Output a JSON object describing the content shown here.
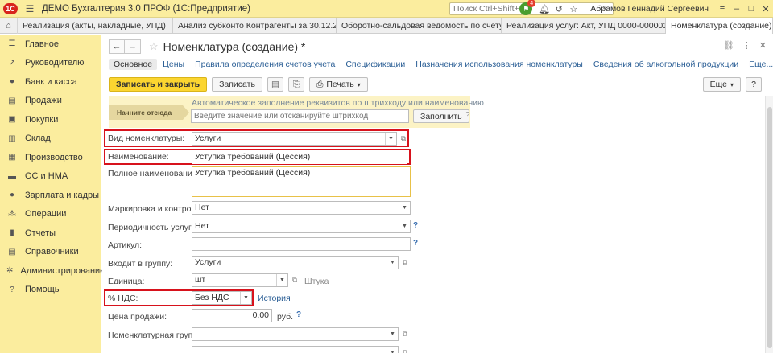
{
  "titlebar": {
    "logo": "1С",
    "title": "ДЕМО Бухгалтерия 3.0 ПРОФ  (1С:Предприятие)",
    "search_placeholder": "Поиск Ctrl+Shift+F",
    "notification_count": "4",
    "user": "Абрамов Геннадий Сергеевич"
  },
  "tabs": [
    {
      "label": "Реализация (акты, накладные, УПД)"
    },
    {
      "label": "Анализ субконто Контрагенты за 30.12.20..."
    },
    {
      "label": "Оборотно-сальдовая ведомость по счету ..."
    },
    {
      "label": "Реализация услуг: Акт, УПД 0000-000001 о..."
    },
    {
      "label": "Номенклатура (создание) *"
    }
  ],
  "sidebar": {
    "items": [
      {
        "icon": "menu-icon",
        "glyph": "☰",
        "label": "Главное"
      },
      {
        "icon": "chart-icon",
        "glyph": "↗",
        "label": "Руководителю"
      },
      {
        "icon": "bank-icon",
        "glyph": "●",
        "label": "Банк и касса"
      },
      {
        "icon": "sales-icon",
        "glyph": "▤",
        "label": "Продажи"
      },
      {
        "icon": "cart-icon",
        "glyph": "▣",
        "label": "Покупки"
      },
      {
        "icon": "warehouse-icon",
        "glyph": "▥",
        "label": "Склад"
      },
      {
        "icon": "factory-icon",
        "glyph": "▦",
        "label": "Производство"
      },
      {
        "icon": "assets-icon",
        "glyph": "▬",
        "label": "ОС и НМА"
      },
      {
        "icon": "people-icon",
        "glyph": "●",
        "label": "Зарплата и кадры"
      },
      {
        "icon": "operations-icon",
        "glyph": "⁂",
        "label": "Операции"
      },
      {
        "icon": "reports-icon",
        "glyph": "▮",
        "label": "Отчеты"
      },
      {
        "icon": "catalogs-icon",
        "glyph": "▤",
        "label": "Справочники"
      },
      {
        "icon": "gear-icon",
        "glyph": "✲",
        "label": "Администрирование"
      },
      {
        "icon": "help-icon",
        "glyph": "?",
        "label": "Помощь"
      }
    ]
  },
  "form": {
    "title": "Номенклатура (создание) *",
    "links": [
      "Основное",
      "Цены",
      "Правила определения счетов учета",
      "Спецификации",
      "Назначения использования номенклатуры",
      "Сведения об алкогольной продукции",
      "Еще..."
    ],
    "toolbar": {
      "save_close": "Записать и закрыть",
      "save": "Записать",
      "print": "Печать",
      "more": "Еще",
      "help": "?"
    },
    "barcode": {
      "start_here": "Начните отсюда",
      "label": "Автоматическое заполнение реквизитов по штрихкоду или наименованию",
      "placeholder": "Введите значение или отсканируйте штрихкод",
      "fill_button": "Заполнить",
      "help": "?"
    },
    "fields": {
      "kind_label": "Вид номенклатуры:",
      "kind_value": "Услуги",
      "name_label": "Наименование:",
      "name_value": "Уступка требований (Цессия)",
      "full_name_label": "Полное наименование:",
      "full_name_value": "Уступка требований (Цессия)",
      "marking_label": "Маркировка и контроль:",
      "marking_value": "Нет",
      "periodicity_label": "Периодичность услуги:",
      "periodicity_value": "Нет",
      "article_label": "Артикул:",
      "article_value": "",
      "group_label": "Входит в группу:",
      "group_value": "Услуги",
      "unit_label": "Единица:",
      "unit_value": "шт",
      "unit_name": "Штука",
      "vat_label": "% НДС:",
      "vat_value": "Без НДС",
      "history_link": "История",
      "price_label": "Цена продажи:",
      "price_value": "0,00",
      "currency": "руб.",
      "nomgroup_label": "Номенклатурная группа:",
      "nomgroup_value": ""
    }
  },
  "colors": {
    "panel_yellow": "#fbed9e",
    "primary_button": "#fbd530",
    "highlight_red": "#d7121c",
    "link_blue": "#2a5e95"
  }
}
